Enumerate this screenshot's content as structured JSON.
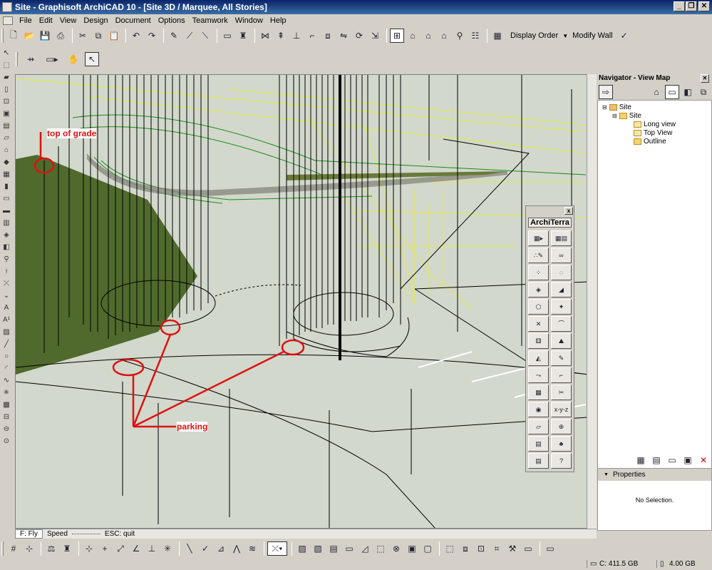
{
  "window": {
    "title": "Site - Graphisoft ArchiCAD 10 - [Site 3D / Marquee, All Stories]",
    "minimize": "_",
    "restore": "❐",
    "close": "✕"
  },
  "menu": [
    "File",
    "Edit",
    "View",
    "Design",
    "Document",
    "Options",
    "Teamwork",
    "Window",
    "Help"
  ],
  "toolbar": {
    "display_order": "Display Order",
    "modify_wall": "Modify Wall"
  },
  "viewport": {
    "annotations": {
      "top_of_grade": "top of grade",
      "parking": "parking"
    },
    "colors": {
      "ground": "#d2d8cc",
      "terrain": "#4f6a2c",
      "annotation": "#e01010",
      "wire_yellow": "#e8e840",
      "wire_green": "#1a8a1a"
    }
  },
  "navigation": {
    "mode": "F: Fly",
    "speed_label": "Speed",
    "quit": "ESC: quit"
  },
  "navigator": {
    "title": "Navigator - View Map",
    "tree": [
      {
        "label": "Site",
        "level": 0
      },
      {
        "label": "Site",
        "level": 1
      },
      {
        "label": "Long view",
        "level": 2
      },
      {
        "label": "Top View",
        "level": 2
      },
      {
        "label": "Outline",
        "level": 2
      }
    ],
    "properties_label": "Properties",
    "no_selection": "No Selection."
  },
  "architerra": {
    "title": "ArchiTerra",
    "close": "x"
  },
  "status": {
    "disk": "C: 411.5 GB",
    "memory": "4.00 GB"
  }
}
